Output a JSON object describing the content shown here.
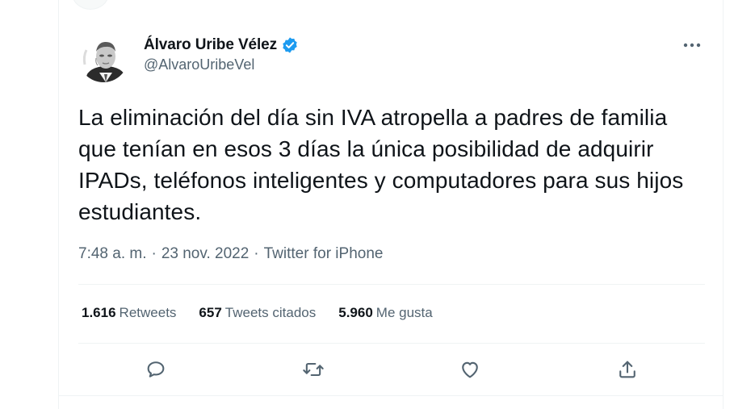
{
  "tweet": {
    "author": {
      "display_name": "Álvaro Uribe Vélez",
      "handle": "@AlvaroUribeVel",
      "verified": true
    },
    "text": "La eliminación del día sin IVA atropella a padres de familia que tenían en esos 3 días la única posibilidad de adquirir IPADs, teléfonos inteligentes y computadores para sus hijos estudiantes.",
    "meta": {
      "time": "7:48 a. m.",
      "sep1": "·",
      "date": "23 nov. 2022",
      "sep2": "·",
      "source": "Twitter for iPhone"
    },
    "stats": {
      "retweets_count": "1.616",
      "retweets_label": "Retweets",
      "quotes_count": "657",
      "quotes_label": "Tweets citados",
      "likes_count": "5.960",
      "likes_label": "Me gusta"
    }
  },
  "actions": [
    {
      "icon": "reply-icon"
    },
    {
      "icon": "retweet-icon"
    },
    {
      "icon": "like-icon"
    },
    {
      "icon": "share-icon"
    }
  ],
  "colors": {
    "verified_badge": "#1d9bf0",
    "secondary_text": "#536471",
    "primary_text": "#0f1419",
    "divider": "#eff3f4"
  }
}
